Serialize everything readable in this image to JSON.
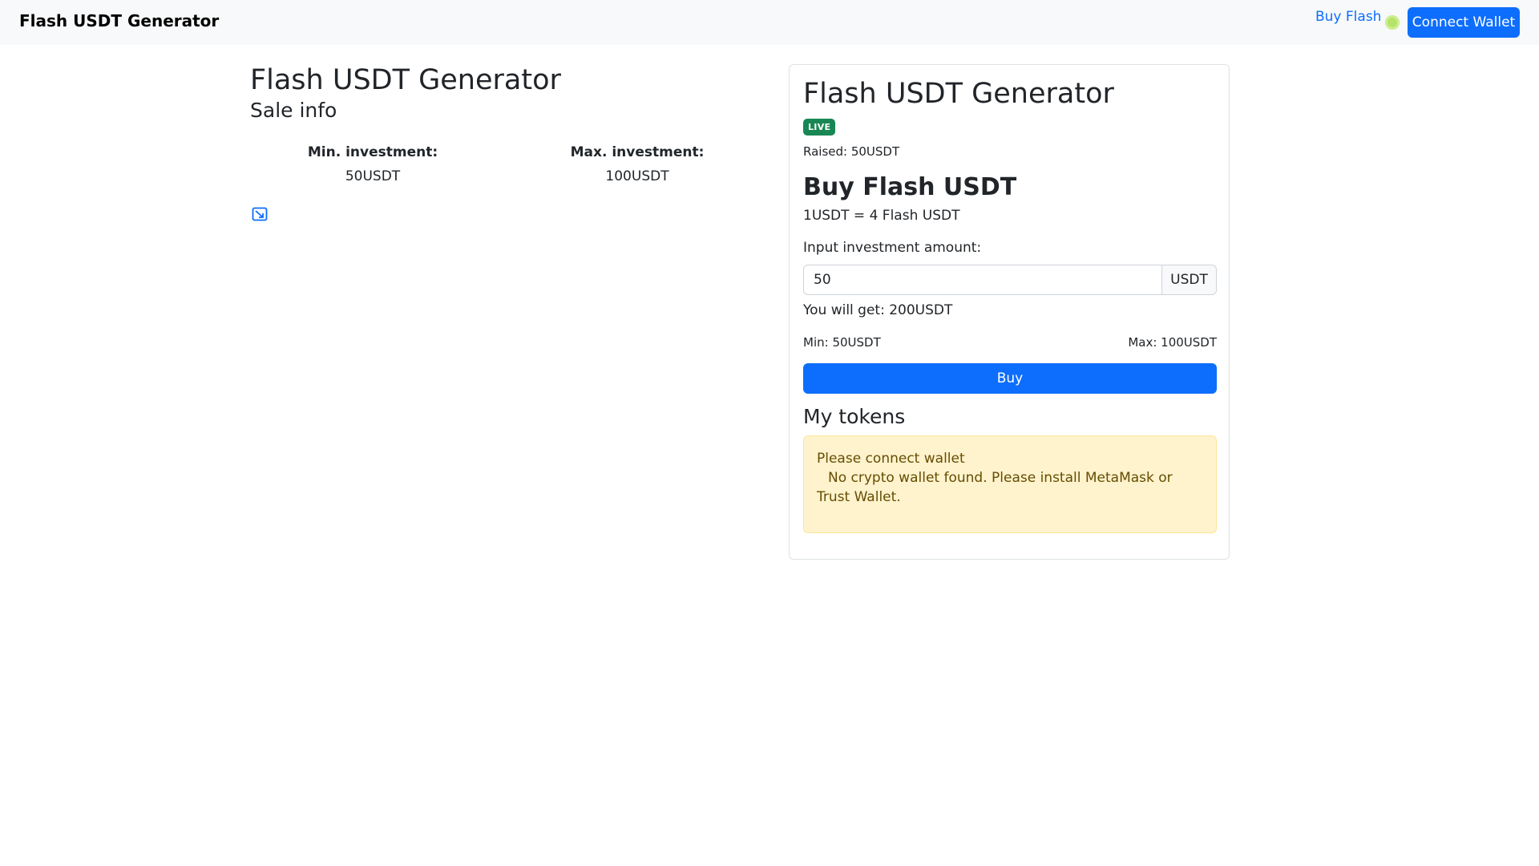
{
  "navbar": {
    "brand": "Flash USDT Generator",
    "link": "Buy Flash",
    "connect_label": "Connect Wallet",
    "status_color": "#b7e36a"
  },
  "sale": {
    "title": "Flash USDT Generator",
    "subtitle": "Sale info",
    "min_label": "Min. investment:",
    "min_value": "50USDT",
    "max_label": "Max. investment:",
    "max_value": "100USDT",
    "broken_image_icon": "image-icon"
  },
  "card": {
    "title": "Flash USDT Generator",
    "badge": "LIVE",
    "raised": "Raised: 50USDT",
    "buy_title": "Buy Flash USDT",
    "rate": "1USDT = 4 Flash USDT",
    "input_label": "Input investment amount:",
    "input_value": "50",
    "input_unit": "USDT",
    "you_get": "You will get: 200USDT",
    "min": "Min: 50USDT",
    "max": "Max: 100USDT",
    "buy_label": "Buy",
    "tokens_title": "My tokens",
    "alert_line1": "Please connect wallet",
    "alert_line2": "No crypto wallet found. Please install MetaMask or Trust Wallet."
  },
  "colors": {
    "primary": "#0d6efd",
    "success": "#198754",
    "warning_bg": "#fff3cd",
    "warning_text": "#664d03"
  }
}
